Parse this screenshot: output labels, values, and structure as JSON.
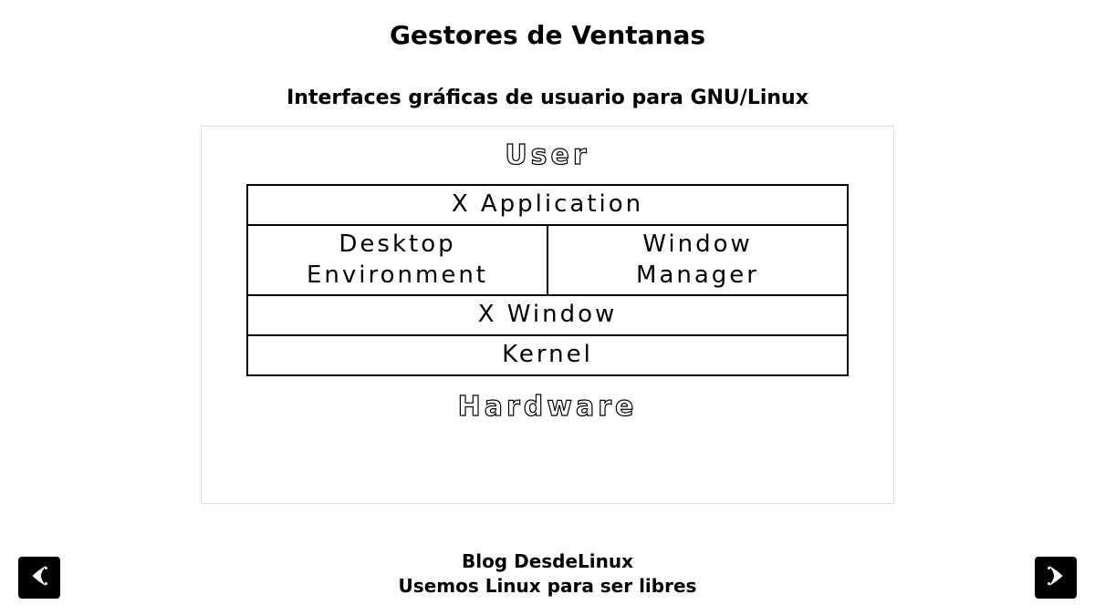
{
  "title": "Gestores de Ventanas",
  "subtitle": "Interfaces gráficas de usuario para GNU/Linux",
  "diagram": {
    "top_label": "User",
    "bottom_label": "Hardware",
    "layers": {
      "l1": "X Application",
      "l2a": "Desktop Environment",
      "l2b": "Window Manager",
      "l3": "X Window",
      "l4": "Kernel"
    }
  },
  "footer": {
    "line1": "Blog DesdeLinux",
    "line2": "Usemos Linux para ser libres"
  }
}
